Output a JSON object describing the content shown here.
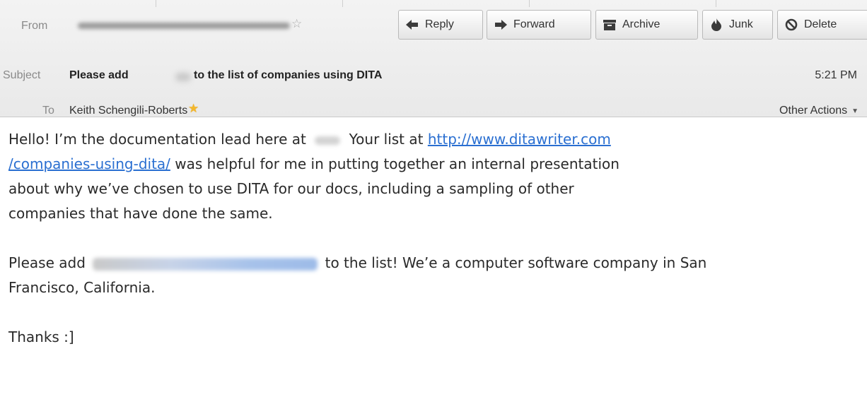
{
  "header": {
    "from_label": "From",
    "subject_label": "Subject",
    "subject": "Please add    to the list of companies using DITA",
    "subject_part1": "Please add",
    "subject_part2": "to the list of companies using DITA",
    "time": "5:21 PM",
    "to_label": "To",
    "to": "Keith Schengili-Roberts",
    "other_actions": "Other Actions"
  },
  "toolbar": {
    "buttons": [
      {
        "label": "Reply",
        "icon": "reply-arrow-icon"
      },
      {
        "label": "Forward",
        "icon": "forward-arrow-icon"
      },
      {
        "label": "Archive",
        "icon": "archive-box-icon"
      },
      {
        "label": "Junk",
        "icon": "junk-flame-icon"
      },
      {
        "label": "Delete",
        "icon": "delete-circle-icon"
      }
    ]
  },
  "message": {
    "p1_part1": "Hello!  I’m the documentation lead here at",
    "p1_part2": "Your list at",
    "link": "http://www.ditawriter.com/companies-using-dita/",
    "link_part1": "http://www.ditawriter.com",
    "link_part2": "/companies-using-dita/",
    "p1_part3": "was helpful for me in putting together an internal presentation",
    "p1_part4": "about why we’ve chosen to use DITA for our docs, including a sampling of other",
    "p1_part5": "companies that have done the same.",
    "p2_part1": "Please add",
    "p2_part2": "to the list!  We’e a computer software company in San",
    "p2_part3": "Francisco, California.",
    "p3": "Thanks  :]"
  },
  "colors": {
    "link": "#2a6fd1",
    "header_bg": "#ececec",
    "star": "#f3b72b"
  }
}
